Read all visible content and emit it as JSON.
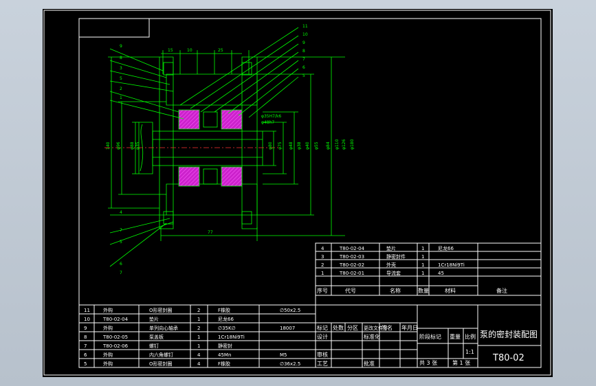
{
  "drawing": {
    "code": "T80-02",
    "title": "泵的密封装配图",
    "scale": "1:1",
    "sheets_total_label": "共 3 张",
    "sheet_label": "第 1 张"
  },
  "upper_parts": {
    "rows": [
      {
        "no": "4",
        "code": "T80-02-04",
        "name": "垫片",
        "qty": "1",
        "material": "尼龙66"
      },
      {
        "no": "3",
        "code": "T80-02-03",
        "name": "静密封件",
        "qty": "1",
        "material": ""
      },
      {
        "no": "2",
        "code": "T80-02-02",
        "name": "外壳",
        "qty": "1",
        "material": "1Cr18Ni9Ti"
      },
      {
        "no": "1",
        "code": "T80-02-01",
        "name": "导流套",
        "qty": "1",
        "material": "45"
      }
    ],
    "header": {
      "no": "序号",
      "code": "代号",
      "name": "名称",
      "qty": "数量",
      "material": "材料",
      "remark": "备注"
    }
  },
  "lower_parts": {
    "rows": [
      {
        "no": "11",
        "code": "外购",
        "name": "O形密封圈",
        "qty": "2",
        "material": "F橡胶",
        "remark": "∅50x2.5"
      },
      {
        "no": "10",
        "code": "T80-02-04",
        "name": "垫片",
        "qty": "1",
        "material": "尼龙66",
        "remark": ""
      },
      {
        "no": "9",
        "code": "外购",
        "name": "单列向心轴承",
        "qty": "2",
        "material": "∅35K∅",
        "remark": "18007"
      },
      {
        "no": "8",
        "code": "T80-02-05",
        "name": "泵盖板",
        "qty": "1",
        "material": "1Cr18Ni9Ti",
        "remark": ""
      },
      {
        "no": "7",
        "code": "T80-02-06",
        "name": "螺钉",
        "qty": "1",
        "material": "静密封",
        "remark": ""
      },
      {
        "no": "6",
        "code": "外购",
        "name": "内六角螺钉",
        "qty": "4",
        "material": "45Mn",
        "remark": "M5"
      },
      {
        "no": "5",
        "code": "外购",
        "name": "O形密封圈",
        "qty": "4",
        "material": "F橡胶",
        "remark": "∅36x2.5"
      }
    ]
  },
  "title_block": {
    "marks_label": "标记",
    "count_label": "处数",
    "zone_label": "分区",
    "change_doc_label": "更改文件号",
    "sign_label": "签名",
    "date_label": "年月日",
    "design_label": "设计",
    "standard_label": "标准化",
    "check_label": "审核",
    "process_label": "工艺",
    "approve_label": "批准",
    "stage_label": "阶段标记",
    "weight_label": "重量",
    "scale_label": "比例"
  },
  "callouts": {
    "left": [
      "9",
      "8",
      "3",
      "5",
      "2",
      "1",
      "4",
      "7",
      "5",
      "6",
      "7"
    ],
    "right": [
      "11",
      "10",
      "9",
      "8",
      "7",
      "6",
      "5"
    ]
  },
  "dimensions": {
    "horizontal": [
      "15",
      "10",
      "25",
      "77"
    ],
    "vertical": [
      "140",
      "φ96",
      "φ88",
      "φ35",
      "φ80",
      "φ75",
      "φ48",
      "φ38",
      "φ40",
      "φ55",
      "φ84",
      "φ110",
      "φ126",
      "φ180"
    ],
    "notes": [
      "φ35H7/k6",
      "φ48h7"
    ]
  },
  "colors": {
    "frame": "#ffffff",
    "lines": "#00ff00",
    "hatch": "#cc33cc",
    "center": "#ff3333",
    "text_table": "#ffffff"
  }
}
